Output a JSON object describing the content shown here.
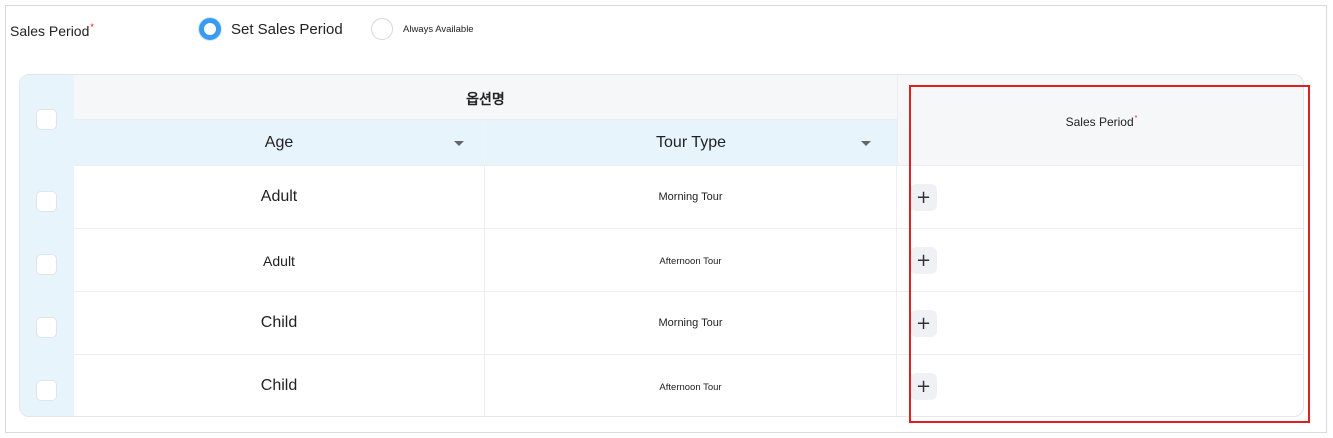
{
  "sales_period": {
    "label": "Sales Period",
    "required_mark": "*",
    "options": [
      {
        "label": "Set Sales Period",
        "selected": true
      },
      {
        "label": "Always Available",
        "selected": false
      }
    ]
  },
  "table": {
    "group_header": "옵션명",
    "columns": {
      "age": "Age",
      "tour_type": "Tour Type",
      "sales_period": "Sales Period",
      "sales_period_required_mark": "*"
    },
    "add_button_label": "+",
    "rows": [
      {
        "age": "Adult",
        "tour_type": "Morning Tour"
      },
      {
        "age": "Adult",
        "tour_type": "Afternoon Tour"
      },
      {
        "age": "Child",
        "tour_type": "Morning Tour"
      },
      {
        "age": "Child",
        "tour_type": "Afternoon Tour"
      }
    ]
  },
  "colors": {
    "accent": "#3a9bf3",
    "header_tint": "#e8f4fc",
    "highlight": "#e02020",
    "required": "#ee1111"
  }
}
